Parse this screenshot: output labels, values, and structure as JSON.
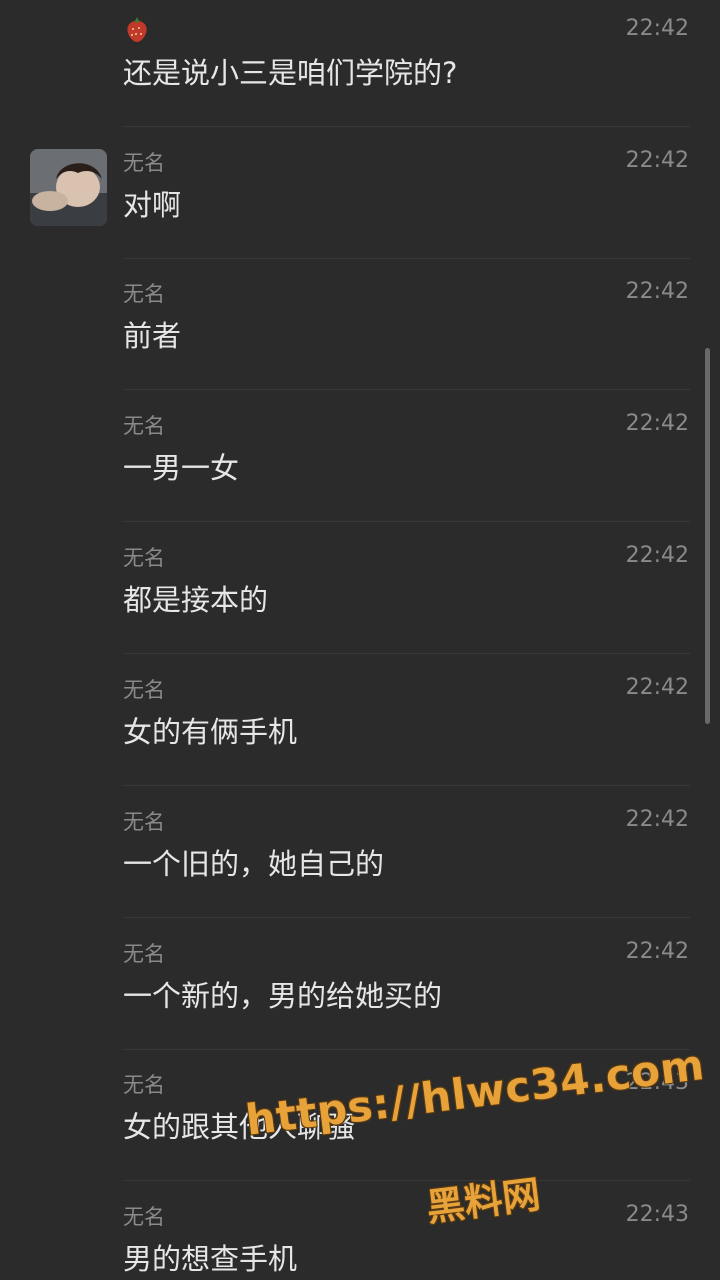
{
  "messages": [
    {
      "name": "",
      "time": "22:42",
      "text": "还是说小三是咱们学院的?",
      "icon": "strawberry-icon",
      "avatar": false
    },
    {
      "name": "无名",
      "time": "22:42",
      "text": "对啊",
      "avatar": true
    },
    {
      "name": "无名",
      "time": "22:42",
      "text": "前者",
      "avatar": false
    },
    {
      "name": "无名",
      "time": "22:42",
      "text": "一男一女",
      "avatar": false
    },
    {
      "name": "无名",
      "time": "22:42",
      "text": "都是接本的",
      "avatar": false
    },
    {
      "name": "无名",
      "time": "22:42",
      "text": "女的有俩手机",
      "avatar": false
    },
    {
      "name": "无名",
      "time": "22:42",
      "text": "一个旧的，她自己的",
      "avatar": false
    },
    {
      "name": "无名",
      "time": "22:42",
      "text": "一个新的，男的给她买的",
      "avatar": false
    },
    {
      "name": "无名",
      "time": "22:43",
      "text": "女的跟其他人聊骚",
      "avatar": false
    },
    {
      "name": "无名",
      "time": "22:43",
      "text": "男的想查手机",
      "avatar": false
    }
  ],
  "watermark": {
    "url": "https://hlwc34.com",
    "name": "黑料网",
    "color": "#e8a23a"
  },
  "colors": {
    "background": "#2b2b2b",
    "text": "#e6e6e6",
    "meta": "#8a8a8a"
  }
}
